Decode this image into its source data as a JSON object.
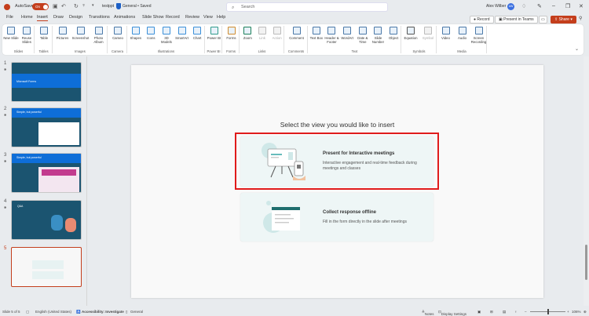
{
  "titlebar": {
    "autosave": "AutoSave",
    "toggle": "On",
    "filename": "testppt",
    "status": "General • Saved",
    "search_placeholder": "Search",
    "user": "Alex Wilber",
    "initials": "AW"
  },
  "tabs": [
    "File",
    "Home",
    "Insert",
    "Draw",
    "Design",
    "Transitions",
    "Animations",
    "Slide Show",
    "Record",
    "Review",
    "View",
    "Help"
  ],
  "active_tab": "Insert",
  "top_buttons": {
    "record": "Record",
    "present_teams": "Present in Teams",
    "share": "Share"
  },
  "ribbon": [
    {
      "label": "Slides",
      "buttons": [
        "New Slide",
        "Reuse Slides"
      ]
    },
    {
      "label": "Tables",
      "buttons": [
        "Table"
      ]
    },
    {
      "label": "Images",
      "buttons": [
        "Pictures",
        "Screenshot",
        "Photo Album"
      ]
    },
    {
      "label": "Camera",
      "buttons": [
        "Cameo"
      ]
    },
    {
      "label": "Illustrations",
      "buttons": [
        "Shapes",
        "Icons",
        "3D Models",
        "SmartArt",
        "Chart"
      ]
    },
    {
      "label": "Power BI",
      "buttons": [
        "Power BI"
      ]
    },
    {
      "label": "Forms",
      "buttons": [
        "Forms"
      ]
    },
    {
      "label": "Links",
      "buttons": [
        "Zoom",
        "Link",
        "Action"
      ],
      "disabled": [
        "Link",
        "Action"
      ]
    },
    {
      "label": "Comments",
      "buttons": [
        "Comment"
      ]
    },
    {
      "label": "Text",
      "buttons": [
        "Text Box",
        "Header & Footer",
        "WordArt",
        "Date & Time",
        "Slide Number",
        "Object"
      ]
    },
    {
      "label": "Symbols",
      "buttons": [
        "Equation",
        "Symbol"
      ],
      "disabled": [
        "Symbol"
      ]
    },
    {
      "label": "Media",
      "buttons": [
        "Video",
        "Audio",
        "Screen Recording"
      ]
    }
  ],
  "slides": [
    {
      "num": "1",
      "title": "Microsoft Forms"
    },
    {
      "num": "2",
      "title": "Simple, but powerful"
    },
    {
      "num": "3",
      "title": "Simple, but powerful"
    },
    {
      "num": "4",
      "title": "Q&A"
    },
    {
      "num": "5",
      "title": "Select the view you would like to insert"
    }
  ],
  "main": {
    "heading": "Select the view you would like to insert",
    "option1": {
      "title": "Present for Interactive meetings",
      "desc": "Interactive engagement and real-time feedback during meetings and classes"
    },
    "option2": {
      "title": "Collect response offline",
      "desc": "Fill in the form directly in the slide after meetings"
    }
  },
  "status": {
    "slide": "Slide 5 of 5",
    "language": "English (United States)",
    "accessibility": "Accessibility: Investigate",
    "label": "General",
    "notes": "Notes",
    "display": "Display Settings",
    "zoom": "106%"
  },
  "colors": {
    "accent": "#c43e1c",
    "highlight": "#e01b1b"
  }
}
